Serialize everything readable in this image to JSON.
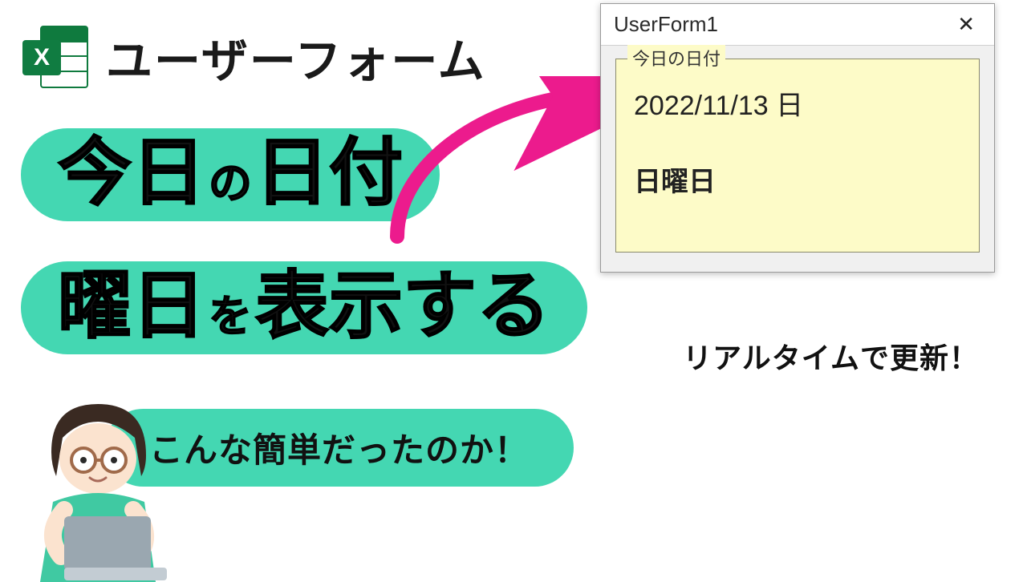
{
  "header": {
    "excel_letter": "X",
    "title": "ユーザーフォーム"
  },
  "pills": {
    "p1_big1": "今日",
    "p1_small": "の",
    "p1_big2": "日付",
    "p2_big1": "曜日",
    "p2_small": "を",
    "p2_big2": "表示する",
    "p3_caption": "こんな簡単だったのか！"
  },
  "userform": {
    "title": "UserForm1",
    "close_glyph": "✕",
    "frame_legend": "今日の日付",
    "date_text": "2022/11/13 日",
    "weekday_text": "日曜日"
  },
  "realtime_caption": "リアルタイムで更新！",
  "colors": {
    "teal": "#44d7b2",
    "excel_green": "#107c41",
    "arrow_pink": "#ec1b8d",
    "frame_yellow": "#fdfbc8"
  }
}
